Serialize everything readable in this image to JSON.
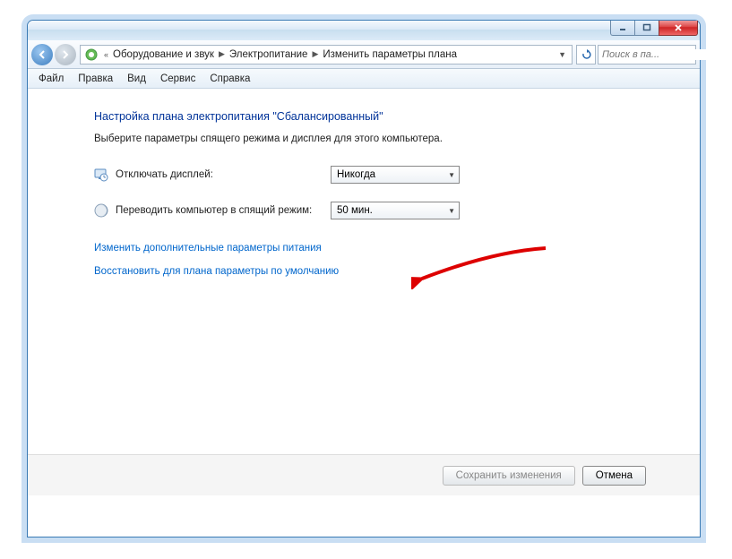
{
  "title_buttons": {
    "minimize": "minimize",
    "maximize": "maximize",
    "close": "close"
  },
  "breadcrumb": {
    "overflow": "«",
    "items": [
      "Оборудование и звук",
      "Электропитание",
      "Изменить параметры плана"
    ]
  },
  "search": {
    "placeholder": "Поиск в па..."
  },
  "menubar": [
    "Файл",
    "Правка",
    "Вид",
    "Сервис",
    "Справка"
  ],
  "page": {
    "title": "Настройка плана электропитания \"Сбалансированный\"",
    "subtitle": "Выберите параметры спящего режима и дисплея для этого компьютера."
  },
  "settings": {
    "display_off": {
      "label": "Отключать дисплей:",
      "value": "Никогда"
    },
    "sleep": {
      "label": "Переводить компьютер в спящий режим:",
      "value": "50 мин."
    }
  },
  "links": {
    "advanced": "Изменить дополнительные параметры питания",
    "restore": "Восстановить для плана параметры по умолчанию"
  },
  "buttons": {
    "save": "Сохранить изменения",
    "cancel": "Отмена"
  }
}
